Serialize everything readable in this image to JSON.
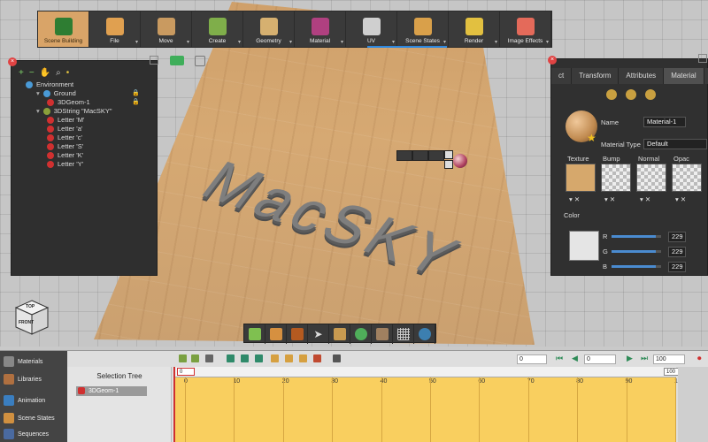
{
  "toolbar": {
    "items": [
      {
        "label": "Scene Building",
        "icon": "scene-building-icon",
        "color": "#2e7d32",
        "active": true
      },
      {
        "label": "File",
        "icon": "file-icon",
        "color": "#e0a050"
      },
      {
        "label": "Move",
        "icon": "move-icon",
        "color": "#c99a60"
      },
      {
        "label": "Create",
        "icon": "create-icon",
        "color": "#7fae4a"
      },
      {
        "label": "Geometry",
        "icon": "geometry-icon",
        "color": "#d6b070"
      },
      {
        "label": "Material",
        "icon": "material-icon",
        "color": "#b04080"
      },
      {
        "label": "UV",
        "icon": "uv-icon",
        "color": "#cfcfcf"
      },
      {
        "label": "Scene States",
        "icon": "scene-states-icon",
        "color": "#d9a04a"
      },
      {
        "label": "Render",
        "icon": "render-icon",
        "color": "#e2c040"
      },
      {
        "label": "Image Effects",
        "icon": "image-effects-icon",
        "color": "#e46a5a"
      }
    ]
  },
  "tree": {
    "toolbar": [
      "+",
      "−"
    ],
    "items": [
      {
        "label": "Environment",
        "indent": 0,
        "color": "#4a9ad6"
      },
      {
        "label": "Ground",
        "indent": 1,
        "color": "#4a9ad6",
        "locked": true
      },
      {
        "label": "3DGeom-1",
        "indent": 2,
        "color": "#d03030",
        "locked": true
      },
      {
        "label": "3DString \"MacSKY\"",
        "indent": 1,
        "color": "#8aa03a"
      },
      {
        "label": "Letter 'M'",
        "indent": 2,
        "color": "#d03030"
      },
      {
        "label": "Letter 'a'",
        "indent": 2,
        "color": "#d03030"
      },
      {
        "label": "Letter 'c'",
        "indent": 2,
        "color": "#d03030"
      },
      {
        "label": "Letter 'S'",
        "indent": 2,
        "color": "#d03030"
      },
      {
        "label": "Letter 'K'",
        "indent": 2,
        "color": "#d03030"
      },
      {
        "label": "Letter 'Y'",
        "indent": 2,
        "color": "#d03030"
      }
    ]
  },
  "viewport": {
    "text3d": "MacSKY",
    "cube_top": "TOP",
    "cube_front": "FRONT"
  },
  "props": {
    "tabs": [
      {
        "label": "ct",
        "active": false
      },
      {
        "label": "Transform",
        "active": false
      },
      {
        "label": "Attributes",
        "active": false
      },
      {
        "label": "Material",
        "active": true
      }
    ],
    "name_label": "Name",
    "name_value": "Material-1",
    "type_label": "Material Type",
    "type_value": "Default",
    "channels": [
      "Texture",
      "Bump",
      "Normal",
      "Opac"
    ],
    "color_label": "Color",
    "rgb": [
      {
        "label": "R",
        "value": "229",
        "level": 0.9
      },
      {
        "label": "G",
        "value": "229",
        "level": 0.9
      },
      {
        "label": "B",
        "value": "229",
        "level": 0.9
      }
    ],
    "swatch_color": "#e5e5e5"
  },
  "leftnav": {
    "items": [
      {
        "label": "Materials",
        "icon": "materials-icon"
      },
      {
        "label": "Libraries",
        "icon": "libraries-icon"
      },
      {
        "label": "Animation",
        "icon": "animation-icon"
      },
      {
        "label": "Scene States",
        "icon": "scene-states-icon"
      },
      {
        "label": "Sequences",
        "icon": "sequences-icon"
      }
    ]
  },
  "timeline": {
    "selection_tree_title": "Selection Tree",
    "selected_item": "3DGeom-1",
    "start_field": "0",
    "current_frame": "0",
    "end_field": "100",
    "ruler_start": "0",
    "ruler_end": "100",
    "ticks": [
      "0",
      "10",
      "20",
      "30",
      "40",
      "50",
      "60",
      "70",
      "80",
      "90",
      "100"
    ]
  }
}
